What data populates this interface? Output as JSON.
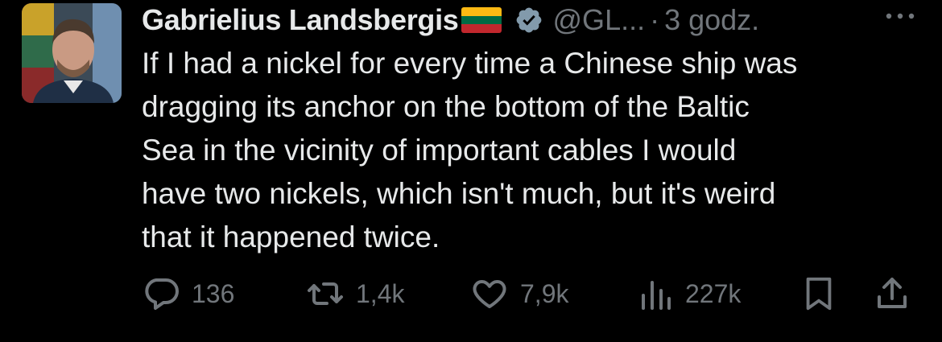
{
  "author": {
    "name": "Gabrielius Landsbergis",
    "flag_colors": [
      "#FDB913",
      "#006A44",
      "#C1272D"
    ],
    "verified_icon": "verified-badge-icon",
    "handle": "@GL...",
    "separator": "·",
    "time": "3 godz."
  },
  "tweet": {
    "text": "If I had a nickel for every time a Chinese ship was\ndragging its anchor on the bottom of the Baltic\nSea in the vicinity of important cables I would\nhave two nickels, which isn't much, but it's weird\nthat it happened twice."
  },
  "actions": {
    "replies": "136",
    "reposts": "1,4k",
    "likes": "7,9k",
    "views": "227k"
  },
  "colors": {
    "background": "#000000",
    "primary_text": "#e7e9ea",
    "secondary_text": "#71767b",
    "verified": "#829aab"
  }
}
